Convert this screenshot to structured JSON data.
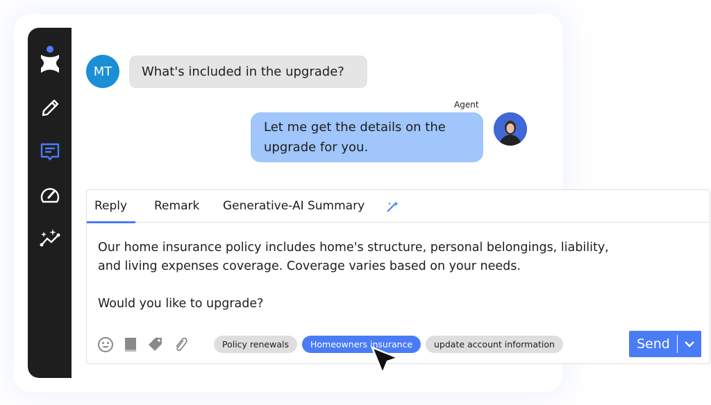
{
  "colors": {
    "accent": "#4a7cf7",
    "sidebar": "#1e1e1e",
    "user_avatar": "#1a8fd6",
    "agent_bubble": "#a0c6fb"
  },
  "sidebar": {
    "items": [
      {
        "icon": "logo-icon"
      },
      {
        "icon": "pencil-icon"
      },
      {
        "icon": "chat-icon",
        "active": true
      },
      {
        "icon": "gauge-icon"
      },
      {
        "icon": "sparkle-trend-icon"
      }
    ]
  },
  "conversation": {
    "user": {
      "initials": "MT",
      "message": "What's included in the upgrade?"
    },
    "agent": {
      "label": "Agent",
      "message": "Let me get the details on the upgrade for you."
    }
  },
  "composer": {
    "tabs": [
      {
        "label": "Reply",
        "active": true
      },
      {
        "label": "Remark"
      },
      {
        "label": "Generative-AI Summary"
      }
    ],
    "text_line1": "Our home insurance policy includes home's structure, personal belongings, liability,",
    "text_line2": "and living expenses coverage. Coverage varies based on your needs.",
    "text_line3": "Would you like to upgrade?",
    "tools": [
      "emoji-icon",
      "book-icon",
      "tag-icon",
      "paperclip-icon"
    ],
    "chips": [
      {
        "label": "Policy renewals"
      },
      {
        "label": "Homeowners insurance",
        "selected": true
      },
      {
        "label": "update account information"
      }
    ],
    "send_label": "Send"
  }
}
